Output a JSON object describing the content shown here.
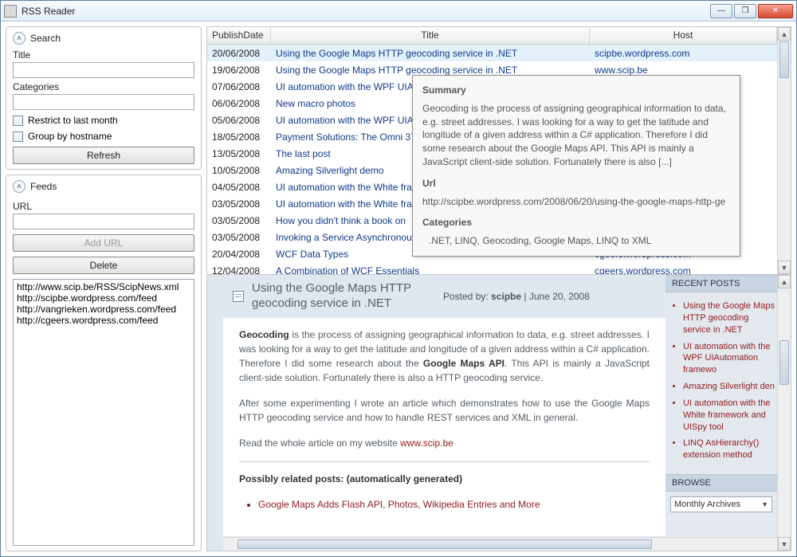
{
  "window": {
    "title": "RSS Reader"
  },
  "sidebar": {
    "search": {
      "header": "Search",
      "title_label": "Title",
      "title_value": "",
      "cat_label": "Categories",
      "cat_value": "",
      "restrict_label": "Restrict to last month",
      "group_label": "Group by hostname",
      "refresh": "Refresh"
    },
    "feeds": {
      "header": "Feeds",
      "url_label": "URL",
      "url_value": "",
      "add": "Add URL",
      "delete": "Delete",
      "items": [
        "http://www.scip.be/RSS/ScipNews.xml",
        "http://scipbe.wordpress.com/feed",
        "http://vangrieken.wordpress.com/feed",
        "http://cgeers.wordpress.com/feed"
      ]
    }
  },
  "grid": {
    "headers": {
      "date": "PublishDate",
      "title": "Title",
      "host": "Host"
    },
    "rows": [
      {
        "date": "20/06/2008",
        "title": "Using the Google Maps HTTP geocoding service in .NET",
        "host": "scipbe.wordpress.com",
        "selected": true
      },
      {
        "date": "19/06/2008",
        "title": "Using the Google Maps HTTP geocoding service in .NET",
        "host": "www.scip.be"
      },
      {
        "date": "07/06/2008",
        "title": "UI automation with the WPF UIA",
        "host": ""
      },
      {
        "date": "06/06/2008",
        "title": "New macro photos",
        "host": ""
      },
      {
        "date": "05/06/2008",
        "title": "UI automation with the WPF UIA",
        "host": ""
      },
      {
        "date": "18/05/2008",
        "title": "Payment Solutions: The Omni 37",
        "host": ""
      },
      {
        "date": "13/05/2008",
        "title": "The last post",
        "host": ""
      },
      {
        "date": "10/05/2008",
        "title": "Amazing Silverlight demo",
        "host": ""
      },
      {
        "date": "04/05/2008",
        "title": "UI automation with the White fra",
        "host": ""
      },
      {
        "date": "03/05/2008",
        "title": "UI automation with the White fra",
        "host": ""
      },
      {
        "date": "03/05/2008",
        "title": "How you didn't think a book on",
        "host": ""
      },
      {
        "date": "03/05/2008",
        "title": "Invoking a Service Asynchronous",
        "host": ""
      },
      {
        "date": "20/04/2008",
        "title": "WCF Data Types",
        "host": "cgeers.wordpress.com"
      },
      {
        "date": "12/04/2008",
        "title": "A Combination of WCF Essentials",
        "host": "cgeers.wordpress.com"
      }
    ]
  },
  "tooltip": {
    "summary_h": "Summary",
    "summary": "Geocoding is the process of assigning geographical information to data, e.g. street addresses. I was looking for a way to get the latitude and longitude of a given address within a C# application. Therefore I did some research about the Google Maps API. This API is mainly a JavaScript client-side solution. Fortunately there is also [...]",
    "url_h": "Url",
    "url": "http://scipbe.wordpress.com/2008/06/20/using-the-google-maps-http-ge",
    "cat_h": "Categories",
    "cat": ".NET, LINQ, Geocoding, Google Maps, LINQ to XML"
  },
  "article": {
    "title": "Using the Google Maps HTTP geocoding service in .NET",
    "posted_by_label": "Posted by:",
    "author": "scipbe",
    "sep": "|",
    "date": "June 20, 2008",
    "p1a": "Geocoding",
    "p1b": " is the process of assigning geographical information to data, e.g. street addresses. I was looking for a way to get the latitude and longitude of a given address within a C# application. Therefore I did some research about the ",
    "p1c": "Google Maps API",
    "p1d": ". This API is mainly a JavaScript client-side solution. Fortunately there is also a HTTP geocoding service.",
    "p2": "After some experimenting I wrote an article which demonstrates how to use the Google Maps HTTP geocoding service and how to handle REST services and XML in general.",
    "p3a": "Read the whole article on my website ",
    "p3b": "www.scip.be",
    "related_h": "Possibly related posts: (automatically generated)",
    "related_1": "Google Maps Adds Flash API, Photos, Wikipedia Entries and More"
  },
  "aside": {
    "recent_h": "RECENT POSTS",
    "recent": [
      "Using the Google Maps HTTP geocoding service in .NET",
      "UI automation with the WPF UIAutomation framewo",
      "Amazing Silverlight den",
      "UI automation with the White framework and UISpy tool",
      "LINQ AsHierarchy() extension method"
    ],
    "browse_h": "BROWSE",
    "combo": "Monthly Archives"
  }
}
